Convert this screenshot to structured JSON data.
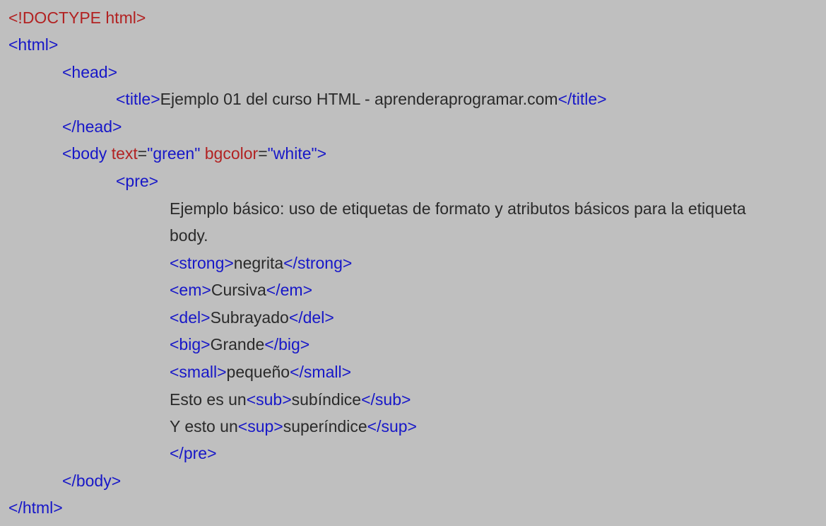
{
  "colors": {
    "background": "#bfbfbf",
    "tag": "#1717c8",
    "doctype_and_attr": "#b22222",
    "text": "#2a2a2a"
  },
  "lines": {
    "doctype": "<!DOCTYPE html>",
    "html_open": "<html>",
    "head_open": "<head>",
    "title_open": "<title>",
    "title_text": "Ejemplo 01 del curso HTML - aprenderaprogramar.com",
    "title_close": "</title>",
    "head_close": "</head>",
    "body_tag_start": "<body ",
    "attr_text": "text",
    "eq1": "=",
    "val_green": "\"green\"",
    "space": " ",
    "attr_bgcolor": "bgcolor",
    "eq2": "=",
    "val_white": "\"white\"",
    "body_tag_end": ">",
    "pre_open": "<pre>",
    "desc_line1": "Ejemplo básico: uso de etiquetas de formato y atributos básicos para la etiqueta",
    "desc_line2": "body.",
    "strong_open": "<strong>",
    "strong_text": "negrita",
    "strong_close": "</strong>",
    "em_open": "<em>",
    "em_text": "Cursiva",
    "em_close": "</em>",
    "del_open": "<del>",
    "del_text": "Subrayado",
    "del_close": "</del>",
    "big_open": "<big>",
    "big_text": "Grande",
    "big_close": "</big>",
    "small_open": "<small>",
    "small_text": "pequeño",
    "small_close": "</small>",
    "sub_prefix": "Esto es un",
    "sub_open": "<sub>",
    "sub_text": "subíndice",
    "sub_close": "</sub>",
    "sup_prefix": "Y esto un",
    "sup_open": "<sup>",
    "sup_text": "superíndice",
    "sup_close": "</sup>",
    "pre_close": "</pre>",
    "body_close": "</body>",
    "html_close": "</html>"
  }
}
